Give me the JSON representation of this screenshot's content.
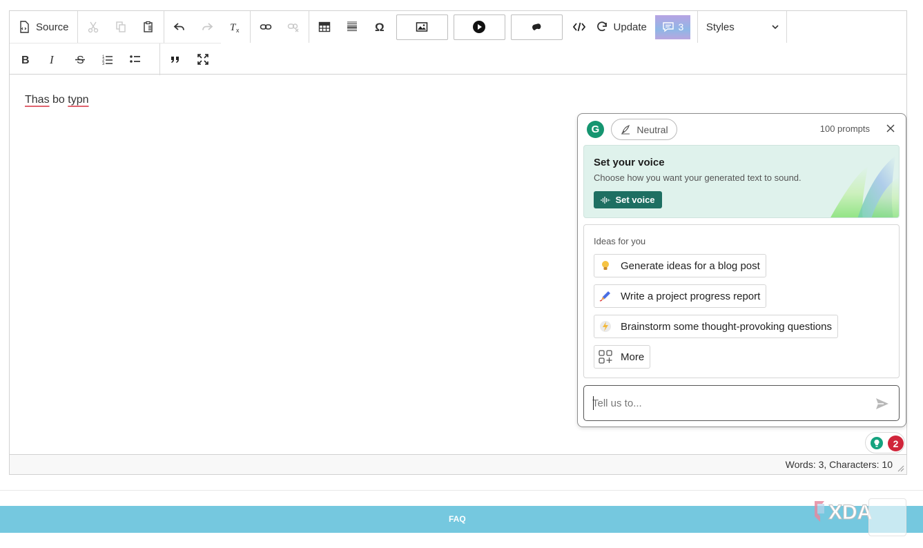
{
  "toolbar": {
    "source_label": "Source",
    "update_label": "Update",
    "comments_count": "3",
    "styles_label": "Styles"
  },
  "editor": {
    "words": [
      "Thas",
      "bo",
      "typn"
    ],
    "word_count_text": "Words: 3, Characters: 10"
  },
  "grammarly": {
    "tone_label": "Neutral",
    "prompts_left": "100 prompts",
    "voice": {
      "title": "Set your voice",
      "description": "Choose how you want your generated text to sound.",
      "button_label": "Set voice"
    },
    "ideas_title": "Ideas for you",
    "ideas": [
      {
        "label": "Generate ideas for a blog post",
        "icon": "lightbulb-icon"
      },
      {
        "label": "Write a project progress report",
        "icon": "pen-icon"
      },
      {
        "label": "Brainstorm some thought-provoking questions",
        "icon": "lightning-icon"
      }
    ],
    "more_label": "More",
    "input_placeholder": "Tell us to...",
    "badge_count": "2"
  },
  "footer": {
    "faq_label": "FAQ",
    "brand": "XDA"
  },
  "colors": {
    "grammarly_green": "#159570",
    "badge_red": "#d0263b",
    "faq_bar": "#75c8df",
    "voice_button": "#1e6f62"
  }
}
